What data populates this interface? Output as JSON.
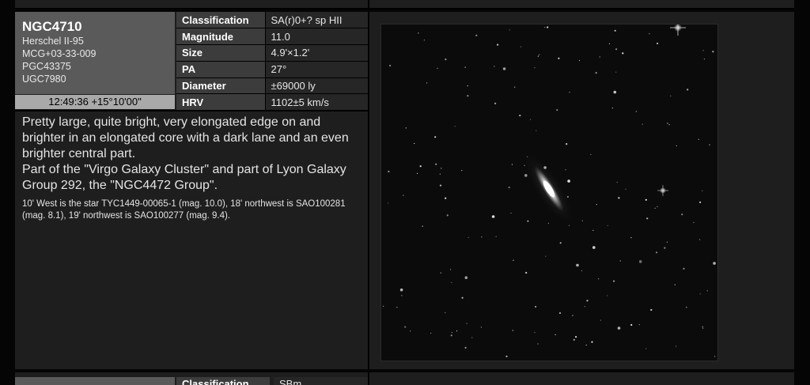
{
  "object": {
    "name": "NGC4710",
    "aliases": [
      "Herschel II-95",
      "MCG+03-33-009",
      "PGC43375",
      "UGC7980"
    ],
    "coordinates": "12:49:36 +15°10'00\""
  },
  "properties": [
    {
      "key": "Classification",
      "value": "SA(r)0+? sp HII"
    },
    {
      "key": "Magnitude",
      "value": "11.0"
    },
    {
      "key": "Size",
      "value": "4.9'×1.2'"
    },
    {
      "key": "PA",
      "value": "27°"
    },
    {
      "key": "Diameter",
      "value": "±69000 ly"
    },
    {
      "key": "HRV",
      "value": "1102±5 km/s"
    }
  ],
  "description": {
    "main": "Pretty large, quite bright, very elongated edge on and brighter in an elongated core with a dark lane and an even brighter central part.",
    "group": "Part of the \"Virgo Galaxy Cluster\" and part of Lyon Galaxy Group 292, the \"NGC4472 Group\".",
    "stars": "10' West is the star TYC1449-00065-1 (mag. 10.0), 18' northwest is SAO100281 (mag. 8.1), 19' northwest is SAO100277 (mag. 9.4)."
  },
  "next_entry": {
    "first_key": "Classification",
    "first_value": "SBm"
  }
}
